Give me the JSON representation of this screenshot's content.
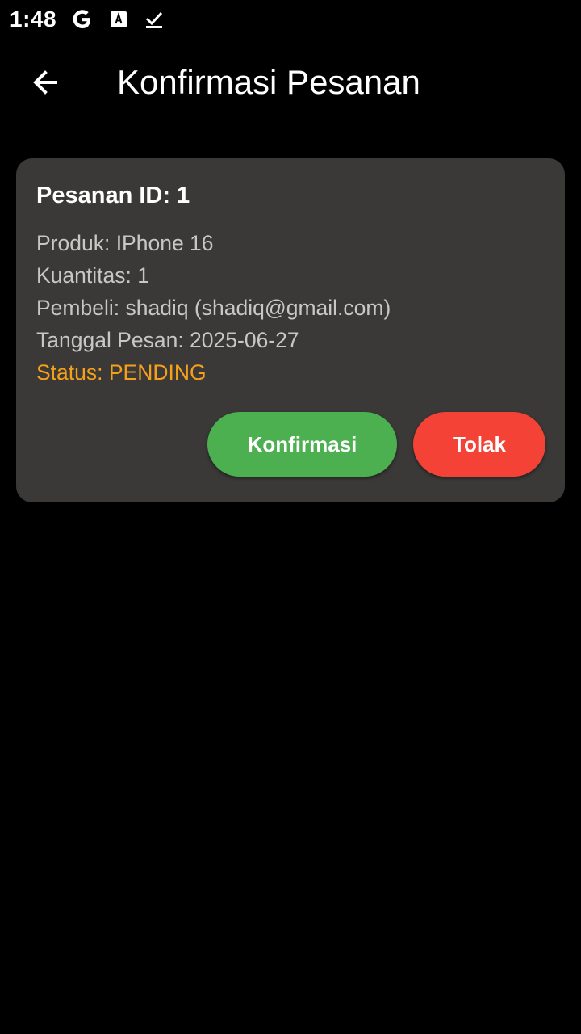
{
  "status_bar": {
    "time": "1:48",
    "icons": [
      "google-icon",
      "text-recognition-icon",
      "download-done-icon"
    ]
  },
  "app_bar": {
    "back_icon": "arrow-back-icon",
    "title": "Konfirmasi Pesanan"
  },
  "order": {
    "title": "Pesanan ID: 1",
    "product": "Produk: IPhone 16",
    "quantity": "Kuantitas: 1",
    "buyer": "Pembeli: shadiq (shadiq@gmail.com)",
    "order_date": "Tanggal Pesan: 2025-06-27",
    "status": "Status: PENDING",
    "confirm_label": "Konfirmasi",
    "reject_label": "Tolak"
  },
  "colors": {
    "background": "#000000",
    "card": "#3a3938",
    "status_pending": "#f5a01a",
    "confirm_button": "#4caf50",
    "reject_button": "#f44336"
  }
}
